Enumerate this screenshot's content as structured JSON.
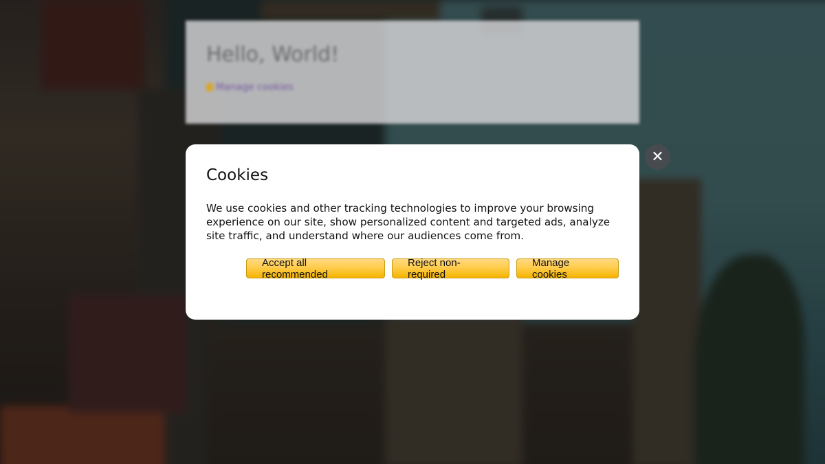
{
  "background_page": {
    "heading": "Hello, World!",
    "manage_link_label": "Manage cookies"
  },
  "cookie_modal": {
    "title": "Cookies",
    "body": "We use cookies and other tracking technologies to improve your browsing experience on our site, show personalized content and targeted ads, analyze site traffic, and understand where our audiences come from.",
    "buttons": {
      "accept_label": "Accept all recommended",
      "reject_label": "Reject non-required",
      "manage_label": "Manage cookies"
    },
    "close_icon_glyph": "✕"
  },
  "colors": {
    "button_accent": "#ffcc4d",
    "close_button_bg": "#474b4f"
  }
}
